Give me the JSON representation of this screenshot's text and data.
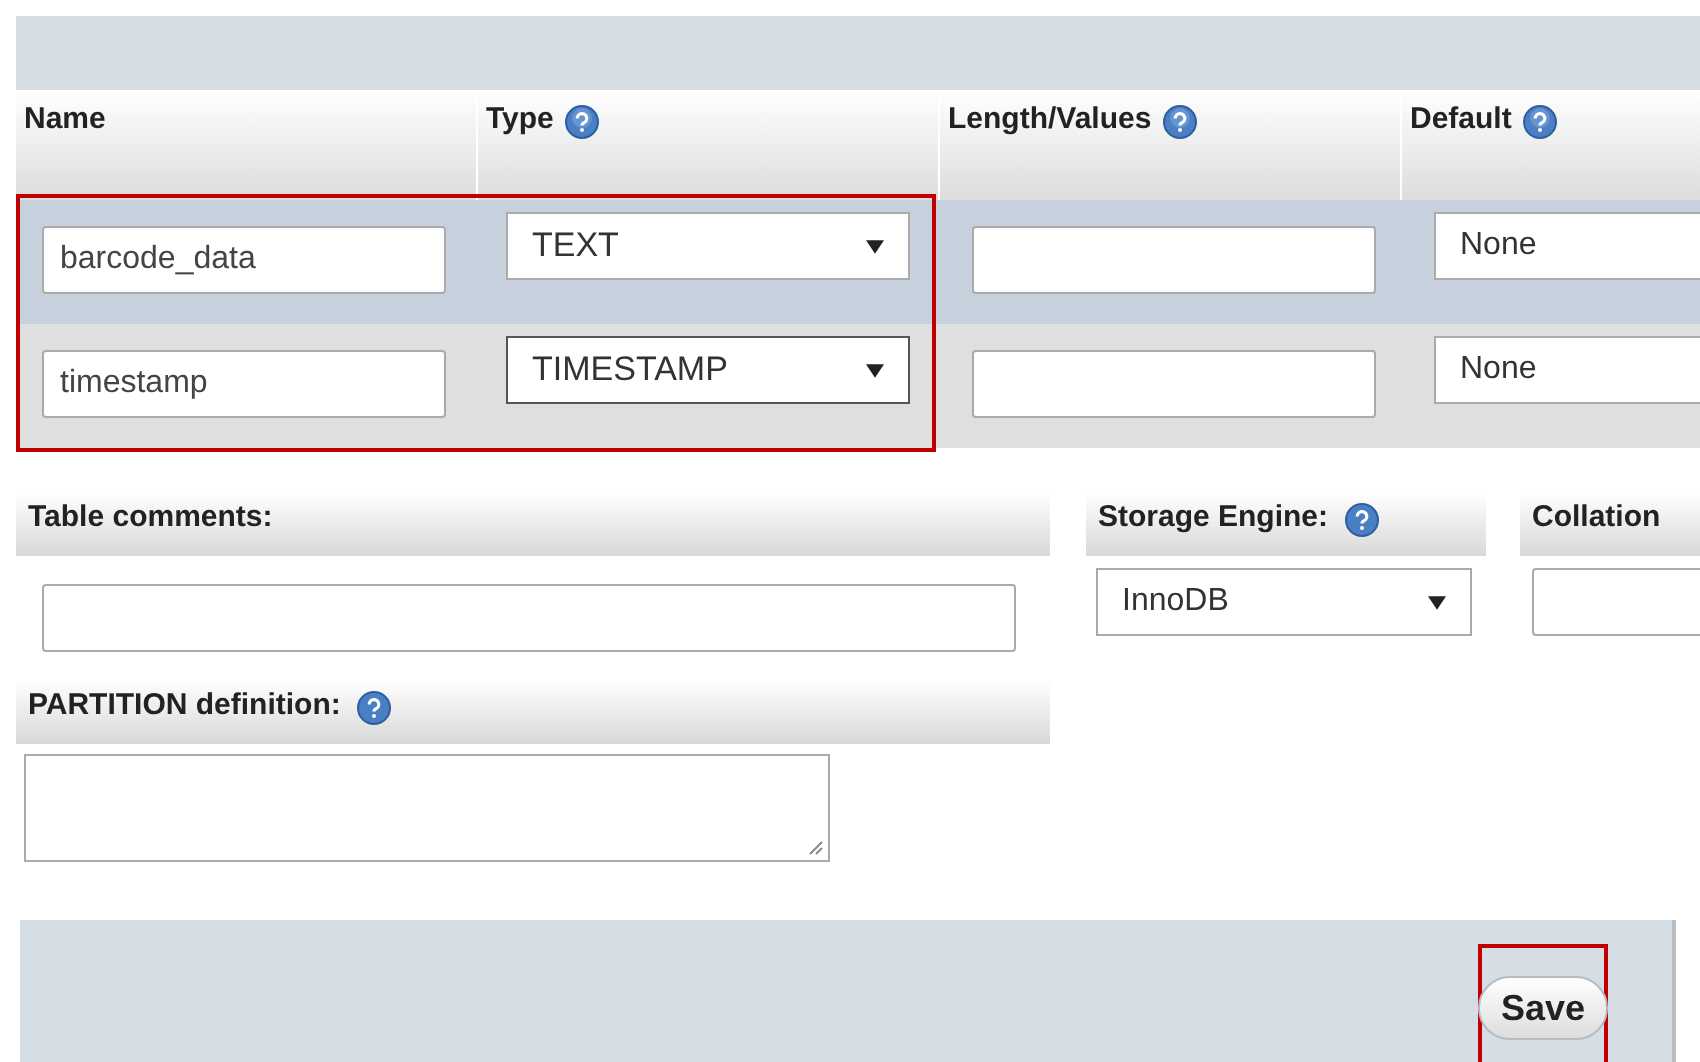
{
  "columns": [
    {
      "label": "Name",
      "help": false
    },
    {
      "label": "Type",
      "help": true
    },
    {
      "label": "Length/Values",
      "help": true
    },
    {
      "label": "Default",
      "help": true
    }
  ],
  "rows": [
    {
      "name": "barcode_data",
      "type": "TEXT",
      "default": "None"
    },
    {
      "name": "timestamp",
      "type": "TIMESTAMP",
      "default": "None"
    }
  ],
  "rows_highlighted": true,
  "table_comments": {
    "label": "Table comments:",
    "help": false
  },
  "storage_engine": {
    "label": "Storage Engine:",
    "help": true,
    "value": "InnoDB"
  },
  "collation": {
    "label": "Collation",
    "help": false
  },
  "partition": {
    "label": "PARTITION definition:",
    "help": true
  },
  "save_button": {
    "label": "Save",
    "highlighted": true
  }
}
